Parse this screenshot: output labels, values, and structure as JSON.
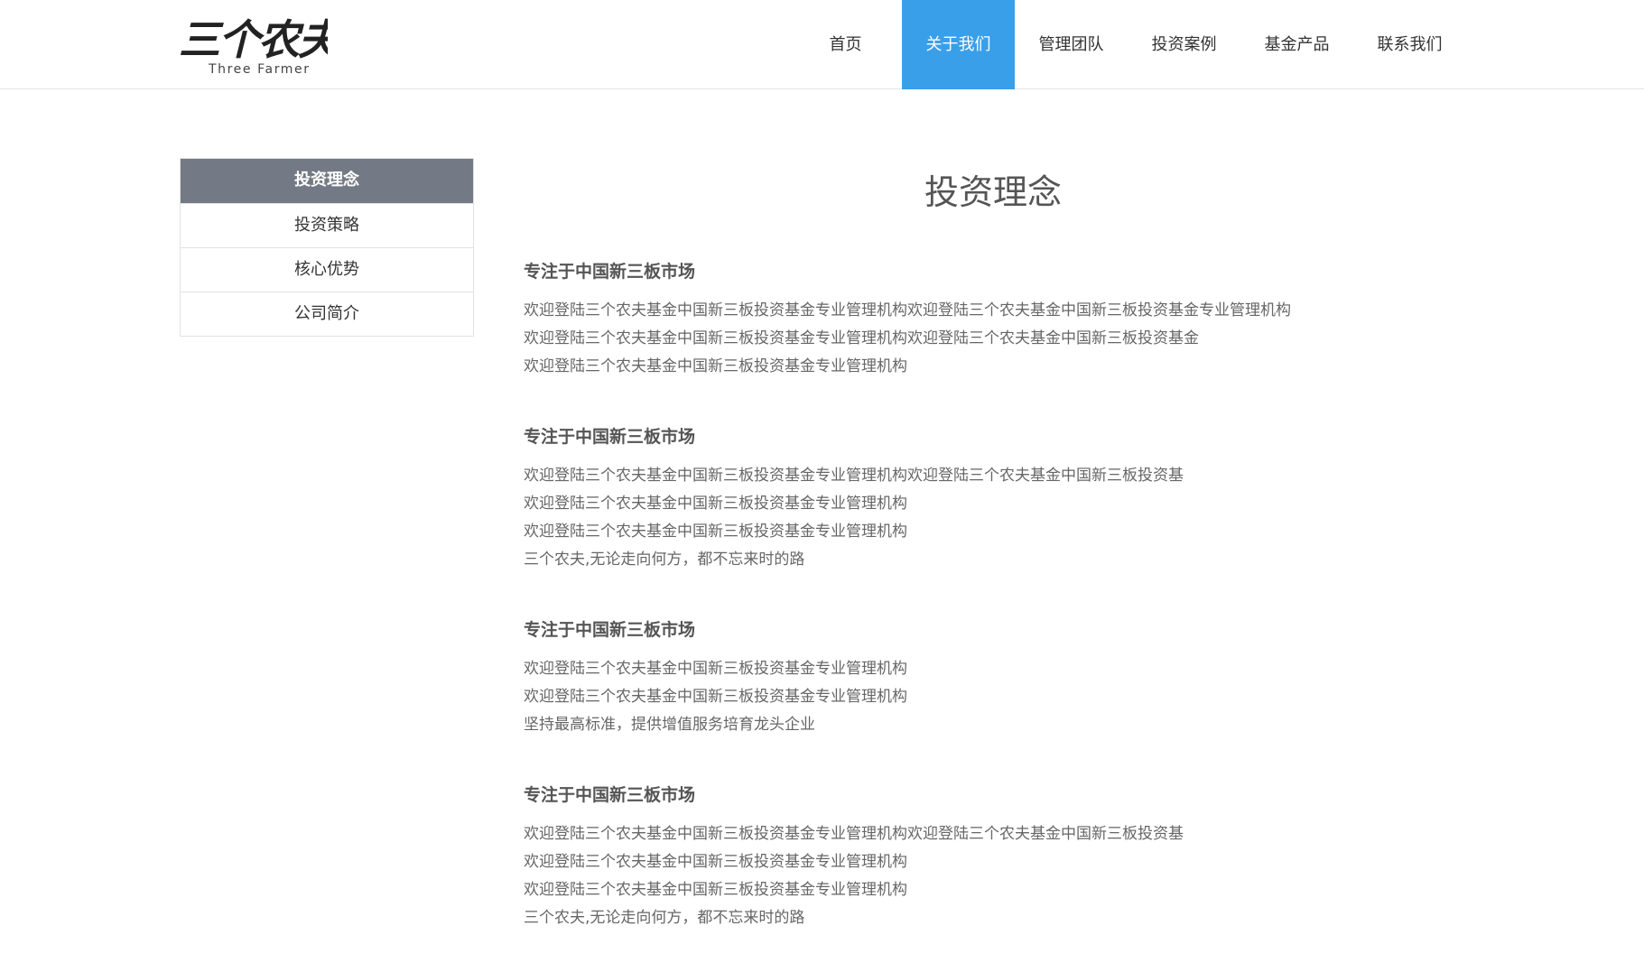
{
  "header": {
    "logo_text": "三个农夫",
    "logo_subtitle": "Three Farmer",
    "nav": [
      {
        "label": "首页",
        "active": false
      },
      {
        "label": "关于我们",
        "active": true
      },
      {
        "label": "管理团队",
        "active": false
      },
      {
        "label": "投资案例",
        "active": false
      },
      {
        "label": "基金产品",
        "active": false
      },
      {
        "label": "联系我们",
        "active": false
      }
    ]
  },
  "sidebar": {
    "items": [
      {
        "label": "投资理念",
        "active": true
      },
      {
        "label": "投资策略",
        "active": false
      },
      {
        "label": "核心优势",
        "active": false
      },
      {
        "label": "公司简介",
        "active": false
      }
    ]
  },
  "main": {
    "title": "投资理念",
    "sections": [
      {
        "heading": "专注于中国新三板市场",
        "lines": [
          "欢迎登陆三个农夫基金中国新三板投资基金专业管理机构欢迎登陆三个农夫基金中国新三板投资基金专业管理机构",
          "欢迎登陆三个农夫基金中国新三板投资基金专业管理机构欢迎登陆三个农夫基金中国新三板投资基金",
          "欢迎登陆三个农夫基金中国新三板投资基金专业管理机构"
        ]
      },
      {
        "heading": "专注于中国新三板市场",
        "lines": [
          "欢迎登陆三个农夫基金中国新三板投资基金专业管理机构欢迎登陆三个农夫基金中国新三板投资基",
          "欢迎登陆三个农夫基金中国新三板投资基金专业管理机构",
          "欢迎登陆三个农夫基金中国新三板投资基金专业管理机构",
          "三个农夫,无论走向何方，都不忘来时的路"
        ]
      },
      {
        "heading": "专注于中国新三板市场",
        "lines": [
          "欢迎登陆三个农夫基金中国新三板投资基金专业管理机构",
          "欢迎登陆三个农夫基金中国新三板投资基金专业管理机构",
          "坚持最高标准，提供增值服务培育龙头企业"
        ]
      },
      {
        "heading": "专注于中国新三板市场",
        "lines": [
          "欢迎登陆三个农夫基金中国新三板投资基金专业管理机构欢迎登陆三个农夫基金中国新三板投资基",
          "欢迎登陆三个农夫基金中国新三板投资基金专业管理机构",
          "欢迎登陆三个农夫基金中国新三板投资基金专业管理机构",
          "三个农夫,无论走向何方，都不忘来时的路"
        ]
      }
    ]
  }
}
